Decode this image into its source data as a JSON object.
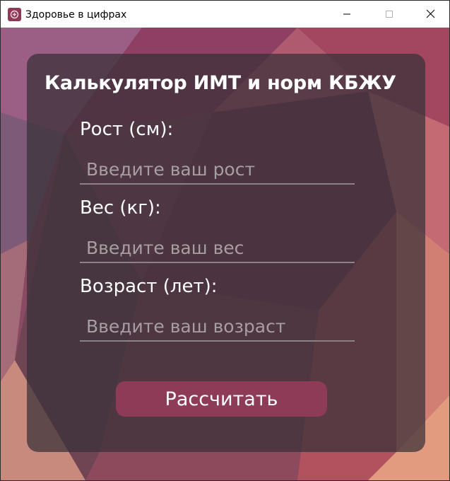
{
  "window": {
    "title": "Здоровье в цифрах",
    "app_icon": "app-logo-icon",
    "controls": [
      "minimize-icon",
      "maximize-icon",
      "close-icon"
    ]
  },
  "calculator": {
    "title": "Калькулятор ИМТ и норм КБЖУ",
    "fields": [
      {
        "label": "Рост (см):",
        "placeholder": "Введите ваш рост",
        "value": ""
      },
      {
        "label": "Вес (кг):",
        "placeholder": "Введите ваш вес",
        "value": ""
      },
      {
        "label": "Возраст (лет):",
        "placeholder": "Введите ваш возраст",
        "value": ""
      }
    ],
    "submit_label": "Рассчитать"
  },
  "colors": {
    "accent": "#8e3b57",
    "card": "#373037",
    "text": "#ffffff",
    "placeholder": "#a79ea2"
  }
}
